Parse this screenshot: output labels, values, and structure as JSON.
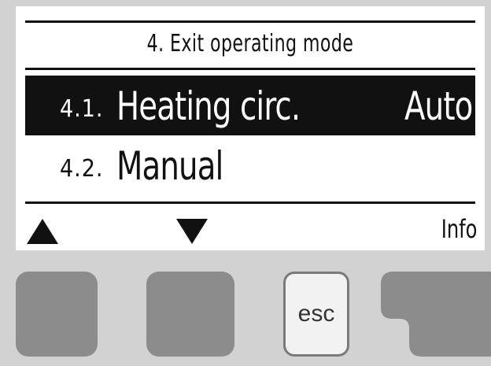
{
  "menu": {
    "title": "4. Exit operating mode",
    "items": [
      {
        "number": "4.1.",
        "label": "Heating circ.",
        "value": "Auto",
        "selected": true
      },
      {
        "number": "4.2.",
        "label": "Manual",
        "value": "",
        "selected": false
      }
    ]
  },
  "softkeys": {
    "up_icon": "triangle-up-icon",
    "down_icon": "triangle-down-icon",
    "info_label": "Info"
  },
  "buttons": {
    "esc_label": "esc"
  },
  "colors": {
    "screen_bg": "#ffffff",
    "text": "#111111",
    "selection_bg": "#111111",
    "device_bg": "#d2d2d2",
    "button_gray": "#8c8c8c"
  }
}
